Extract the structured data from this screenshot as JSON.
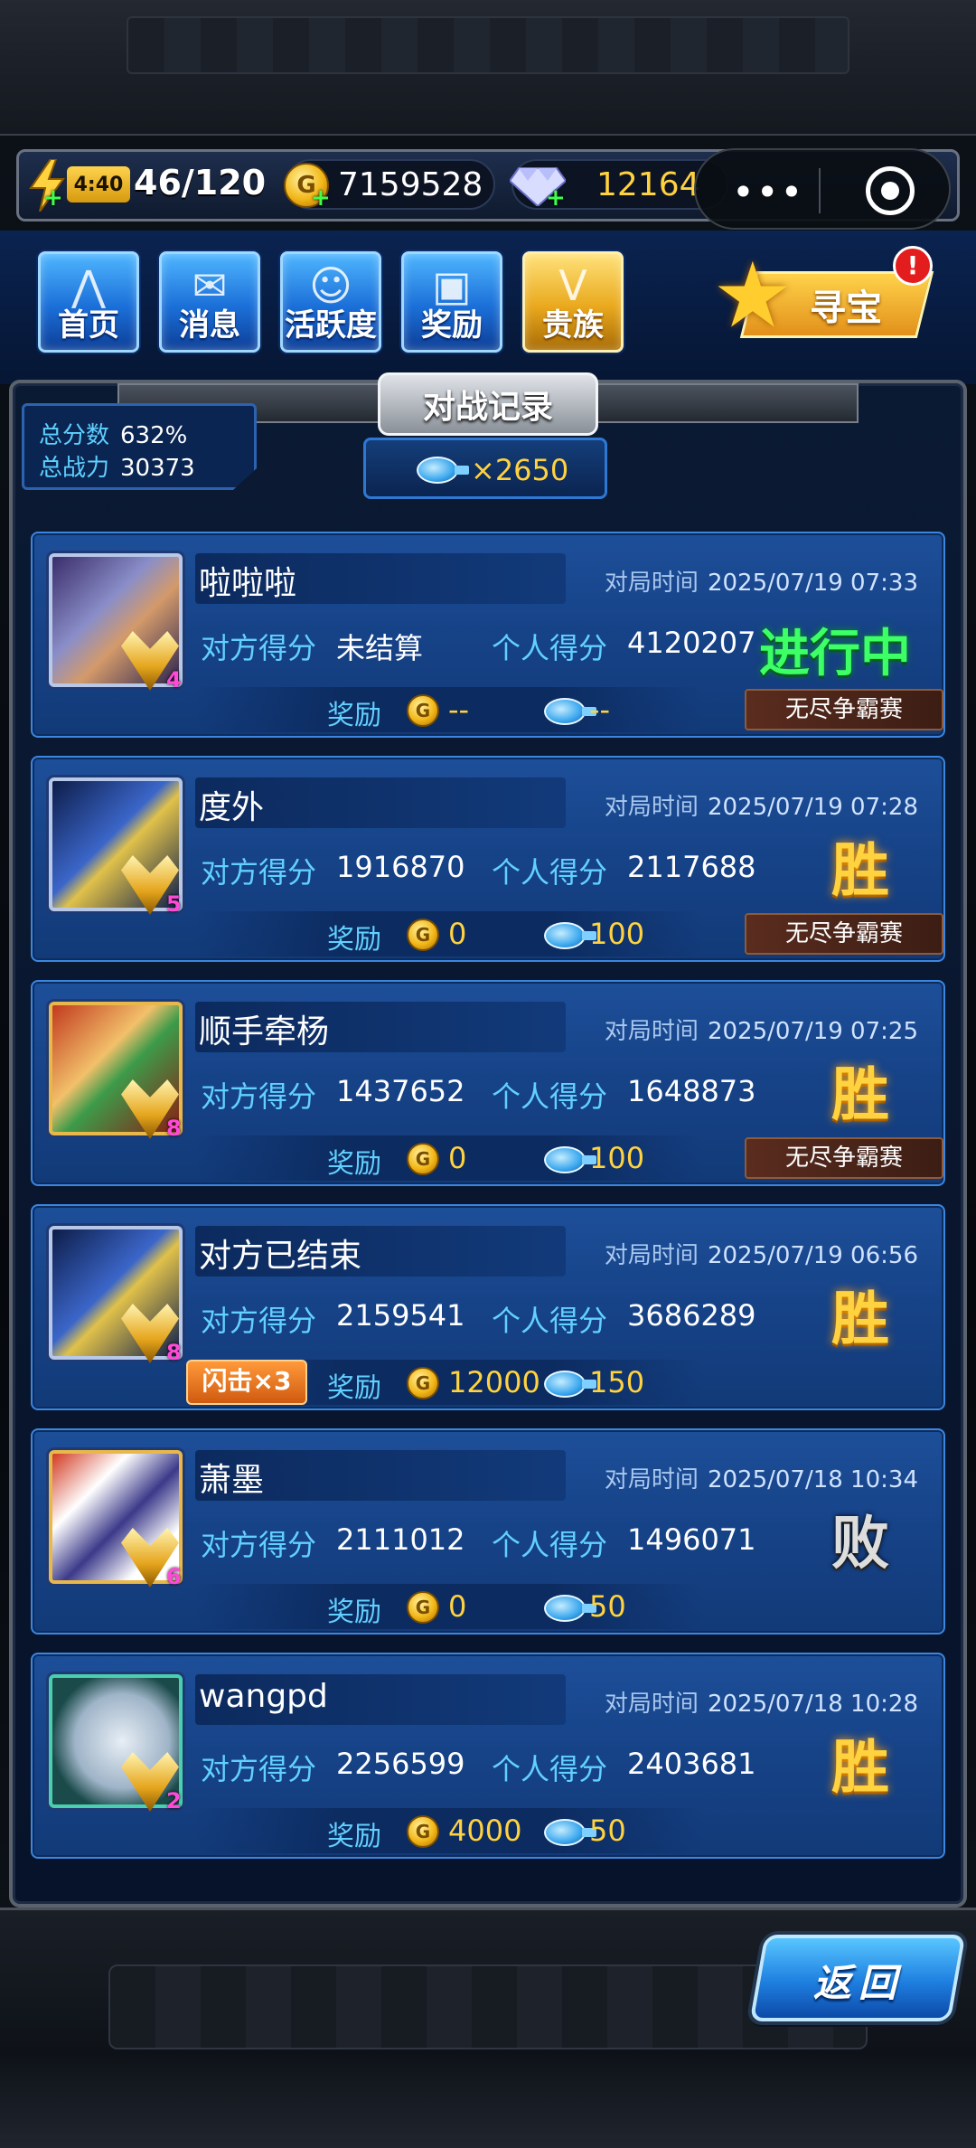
{
  "resources": {
    "energy_timer": "4:40",
    "energy": "46/120",
    "coins": "7159528",
    "diamonds": "12164"
  },
  "nav": {
    "items": [
      {
        "label": "首页"
      },
      {
        "label": "消息"
      },
      {
        "label": "活跃度"
      },
      {
        "label": "奖励"
      },
      {
        "label": "贵族"
      }
    ],
    "treasure_label": "寻宝",
    "treasure_badge": "!"
  },
  "panel": {
    "title": "对战记录",
    "total_score_label": "总分数",
    "total_score_value": "632%",
    "total_power_label": "总战力",
    "total_power_value": "30373",
    "tickets": "×2650"
  },
  "labels": {
    "time": "对局时间",
    "opp_score": "对方得分",
    "my_score": "个人得分",
    "reward": "奖励"
  },
  "records": [
    {
      "name": "啦啦啦",
      "time": "2025/07/19 07:33",
      "opp": "未结算",
      "mine": "4120207",
      "result": "进行中",
      "coin": "--",
      "ticket": "--",
      "mode": "无尽争霸赛",
      "vip": "4"
    },
    {
      "name": "度外",
      "time": "2025/07/19 07:28",
      "opp": "1916870",
      "mine": "2117688",
      "result": "胜",
      "coin": "0",
      "ticket": "100",
      "mode": "无尽争霸赛",
      "vip": "5"
    },
    {
      "name": "顺手牵杨",
      "time": "2025/07/19 07:25",
      "opp": "1437652",
      "mine": "1648873",
      "result": "胜",
      "coin": "0",
      "ticket": "100",
      "mode": "无尽争霸赛",
      "vip": "8"
    },
    {
      "name": "对方已结束",
      "time": "2025/07/19 06:56",
      "opp": "2159541",
      "mine": "3686289",
      "result": "胜",
      "coin": "12000",
      "ticket": "150",
      "flash": "闪击×3",
      "vip": "8"
    },
    {
      "name": "萧墨",
      "time": "2025/07/18 10:34",
      "opp": "2111012",
      "mine": "1496071",
      "result": "败",
      "coin": "0",
      "ticket": "50",
      "vip": "6"
    },
    {
      "name": "wangpd",
      "time": "2025/07/18 10:28",
      "opp": "2256599",
      "mine": "2403681",
      "result": "胜",
      "coin": "4000",
      "ticket": "50",
      "vip": "2"
    }
  ],
  "back_label": "返回",
  "icons": [
    "lightning-icon",
    "coin-icon",
    "diamond-icon",
    "more-dots-icon",
    "target-icon",
    "star-jet-icon",
    "ticket-icon"
  ]
}
